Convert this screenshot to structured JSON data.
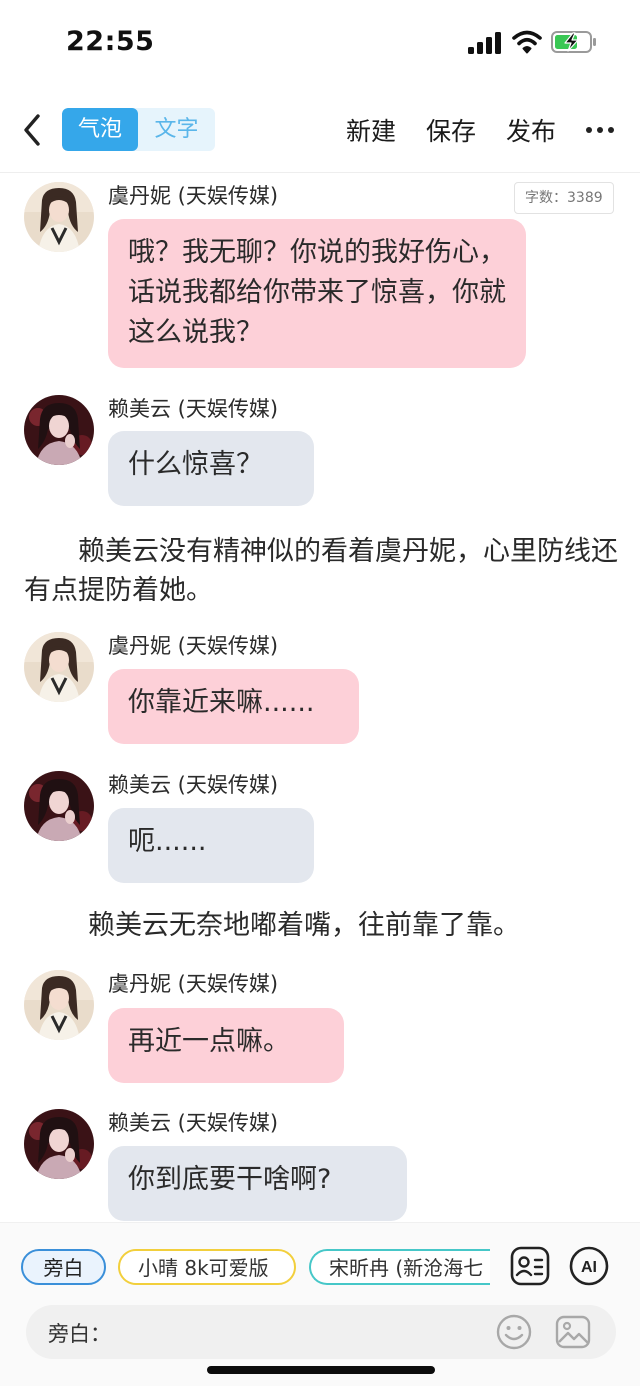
{
  "status_bar": {
    "time": "22:55"
  },
  "nav": {
    "mode_bubble": "气泡",
    "mode_text": "文字",
    "new_label": "新建",
    "save_label": "保存",
    "publish_label": "发布"
  },
  "word_count": "字数：3389",
  "messages": [
    {
      "sender": "虞丹妮 (天娱传媒)",
      "text": "哦？我无聊？你说的我好伤心，话说我都给你带来了惊喜，你就这么说我？"
    },
    {
      "sender": "赖美云 (天娱传媒)",
      "text": "什么惊喜？"
    },
    {
      "narration": "　　赖美云没有精神似的看着虞丹妮，心里防线还有点提防着她。"
    },
    {
      "sender": "虞丹妮 (天娱传媒)",
      "text": "你靠近来嘛......"
    },
    {
      "sender": "赖美云 (天娱传媒)",
      "text": "呃......"
    },
    {
      "narration": "赖美云无奈地嘟着嘴，往前靠了靠。"
    },
    {
      "sender": "虞丹妮 (天娱传媒)",
      "text": "再近一点嘛。"
    },
    {
      "sender": "赖美云 (天娱传媒)",
      "text": "你到底要干啥啊?"
    }
  ],
  "bottom": {
    "chips": [
      "旁白",
      "小晴 8k可爱版",
      "宋昕冉 (新沧海七"
    ],
    "ai_label": "AI",
    "input_label": "旁白："
  },
  "colors": {
    "accent": "#35a7ea",
    "bubble_pink": "#fdd0d8",
    "bubble_gray": "#e3e7ee",
    "chip_narrator": "#3a8fd9",
    "chip_yellow": "#f2cf3c",
    "chip_teal": "#46c7c8"
  },
  "icons": [
    "signal-icon",
    "wifi-icon",
    "battery-charging-icon",
    "back-chevron-icon",
    "more-icon",
    "contact-card-icon",
    "ai-icon",
    "emoji-icon",
    "image-icon"
  ]
}
